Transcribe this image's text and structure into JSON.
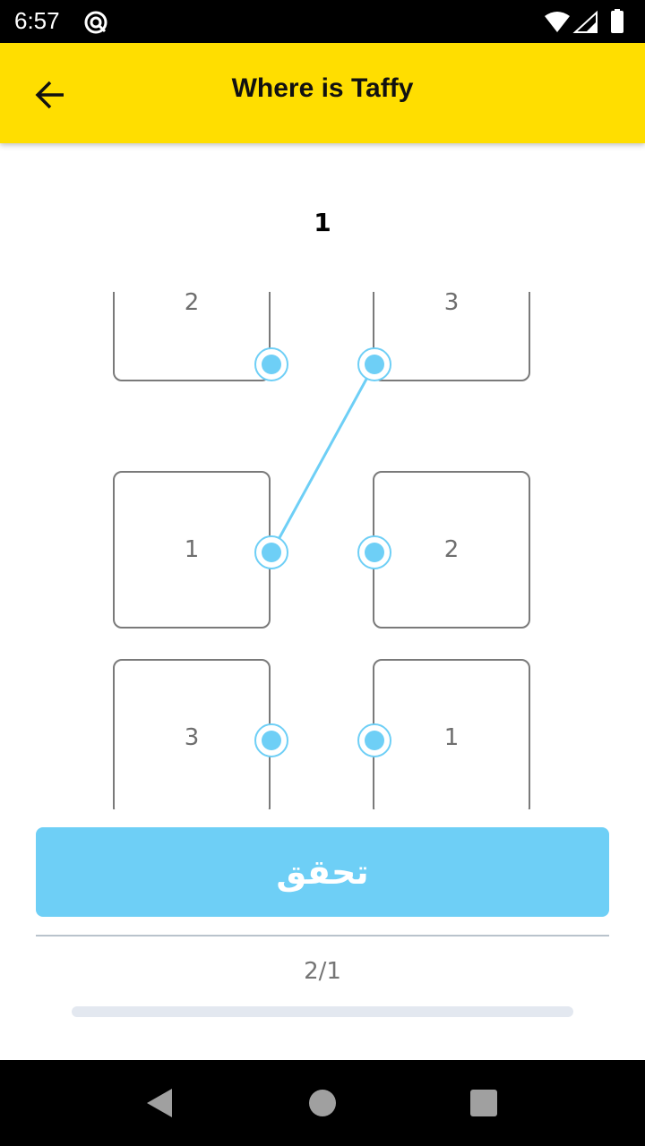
{
  "status_bar": {
    "time": "6:57",
    "icons": [
      "app-notification-icon",
      "wifi-icon",
      "signal-icon",
      "battery-icon"
    ]
  },
  "app_bar": {
    "title": "Where is Taffy",
    "back_icon": "arrow-left-icon",
    "background_color": "#FFDE00"
  },
  "game": {
    "level": "1",
    "left_column": [
      "2",
      "1",
      "3"
    ],
    "right_column": [
      "3",
      "2",
      "1"
    ],
    "connections": [
      {
        "from_left_index": 1,
        "to_right_index": 0
      }
    ],
    "accent_color": "#6ECFF6"
  },
  "check_button": {
    "label": "تحقق"
  },
  "progress": {
    "text": "2/1",
    "fraction": 0
  },
  "nav_bar": {
    "icons": [
      "back-triangle-icon",
      "home-circle-icon",
      "recents-square-icon"
    ]
  }
}
